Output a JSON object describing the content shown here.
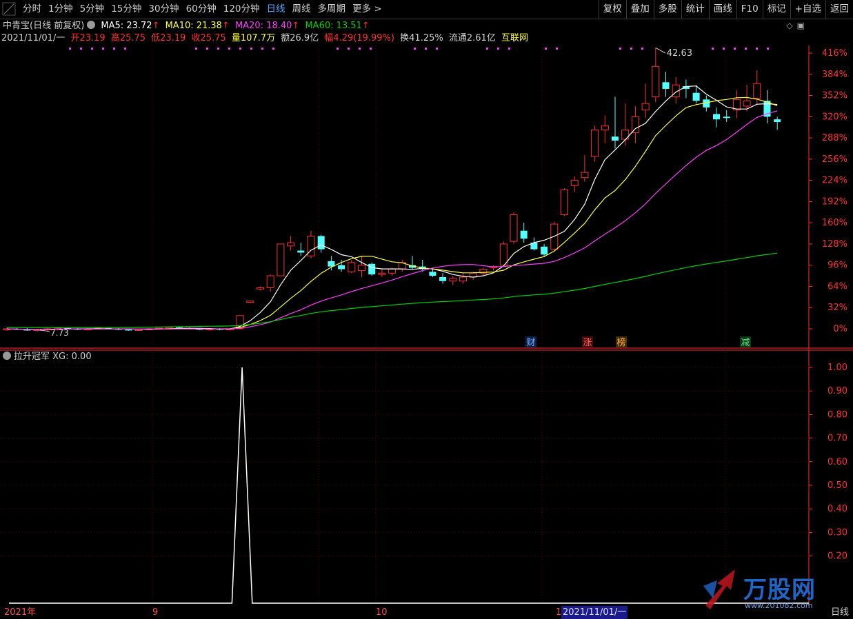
{
  "toolbar": {
    "periods": [
      {
        "label": "分时"
      },
      {
        "label": "1分钟"
      },
      {
        "label": "5分钟"
      },
      {
        "label": "15分钟"
      },
      {
        "label": "30分钟"
      },
      {
        "label": "60分钟"
      },
      {
        "label": "120分钟"
      },
      {
        "label": "日线",
        "active": true
      },
      {
        "label": "周线"
      },
      {
        "label": "多周期"
      },
      {
        "label": "更多 >"
      }
    ],
    "right_buttons": [
      "复权",
      "叠加",
      "多股",
      "统计",
      "画线",
      "F10",
      "标记",
      "+自选",
      "返回"
    ]
  },
  "stock": {
    "name": "中青宝(日线 前复权)",
    "ma5": "MA5: 23.72",
    "ma10": "MA10: 21.38",
    "ma20": "MA20: 18.40",
    "ma60": "MA60: 13.51",
    "date": "2021/11/01/一",
    "open": "开23.19",
    "high": "高25.75",
    "low": "低23.19",
    "close": "收25.75",
    "volume": "量107.7万",
    "amount": "额26.9亿",
    "change": "幅4.29(19.99%)",
    "turnover": "换41.25%",
    "float": "流通2.61亿",
    "sector": "互联网"
  },
  "colors": {
    "up": "#ff3030",
    "down": "#54ffff",
    "ma5": "#ffffff",
    "ma10": "#ffff3c",
    "ma20": "#ff3cff",
    "ma60": "#00d000",
    "axis": "#ff3030",
    "grid": "#5a0000"
  },
  "price_axis": {
    "labels": [
      "416%",
      "384%",
      "352%",
      "320%",
      "288%",
      "256%",
      "224%",
      "192%",
      "160%",
      "128%",
      "96%",
      "64%",
      "32%",
      "0%"
    ]
  },
  "annotations": {
    "high_label": "42.63",
    "low_label": "7.73",
    "events": [
      "财",
      "涨",
      "榜",
      "减"
    ]
  },
  "indicator": {
    "name": "拉升冠军",
    "value": "XG: 0.00",
    "axis_labels": [
      "1.00",
      "0.90",
      "0.80",
      "0.70",
      "0.60",
      "0.50",
      "0.40",
      "0.30",
      "0.20"
    ]
  },
  "xaxis": {
    "labels": [
      "2021年",
      "9",
      "10",
      "1",
      "2021/11/01/一"
    ],
    "period": "日线"
  },
  "watermark": {
    "brand": "万股网",
    "url": "www.201082.com"
  },
  "chart_data": [
    {
      "type": "candlestick",
      "title": "中青宝(日线 前复权)",
      "y_axis": "percent change",
      "ylim": [
        0,
        416
      ],
      "candles_pct": [
        [
          0,
          2,
          -3,
          0
        ],
        [
          0,
          1,
          -2,
          -1
        ],
        [
          -1,
          1,
          -3,
          -2
        ],
        [
          -2,
          0,
          -4,
          -1
        ],
        [
          -1,
          1,
          -3,
          0
        ],
        [
          0,
          2,
          -2,
          1
        ],
        [
          1,
          2,
          -1,
          0
        ],
        [
          0,
          1,
          -2,
          -1
        ],
        [
          -1,
          1,
          -2,
          0
        ],
        [
          0,
          2,
          -1,
          1
        ],
        [
          1,
          2,
          -1,
          0
        ],
        [
          0,
          1,
          -2,
          -1
        ],
        [
          -1,
          0,
          -3,
          -2
        ],
        [
          -2,
          0,
          -3,
          -1
        ],
        [
          -1,
          1,
          -2,
          0
        ],
        [
          0,
          2,
          -1,
          1
        ],
        [
          1,
          3,
          0,
          2
        ],
        [
          2,
          3,
          0,
          1
        ],
        [
          1,
          2,
          -1,
          0
        ],
        [
          0,
          1,
          -2,
          -1
        ],
        [
          -1,
          1,
          -3,
          0
        ],
        [
          0,
          1,
          -2,
          -1
        ],
        [
          -1,
          0,
          -2,
          0
        ],
        [
          0,
          20,
          0,
          20
        ],
        [
          40,
          42,
          40,
          42
        ],
        [
          60,
          64,
          58,
          62
        ],
        [
          62,
          82,
          56,
          80
        ],
        [
          80,
          128,
          80,
          128
        ],
        [
          125,
          140,
          118,
          130
        ],
        [
          118,
          130,
          110,
          115
        ],
        [
          110,
          148,
          106,
          140
        ],
        [
          140,
          142,
          115,
          120
        ],
        [
          102,
          110,
          88,
          94
        ],
        [
          96,
          104,
          86,
          90
        ],
        [
          86,
          104,
          84,
          100
        ],
        [
          88,
          110,
          78,
          96
        ],
        [
          98,
          100,
          80,
          82
        ],
        [
          82,
          90,
          78,
          84
        ],
        [
          84,
          92,
          80,
          90
        ],
        [
          90,
          104,
          86,
          100
        ],
        [
          96,
          110,
          90,
          92
        ],
        [
          94,
          104,
          86,
          90
        ],
        [
          86,
          92,
          78,
          80
        ],
        [
          78,
          84,
          68,
          72
        ],
        [
          72,
          80,
          66,
          76
        ],
        [
          72,
          84,
          68,
          78
        ],
        [
          78,
          86,
          74,
          84
        ],
        [
          84,
          92,
          80,
          90
        ],
        [
          92,
          96,
          88,
          94
        ],
        [
          96,
          132,
          94,
          128
        ],
        [
          132,
          176,
          128,
          172
        ],
        [
          148,
          160,
          130,
          136
        ],
        [
          130,
          138,
          118,
          120
        ],
        [
          124,
          128,
          108,
          112
        ],
        [
          120,
          162,
          118,
          158
        ],
        [
          172,
          212,
          170,
          210
        ],
        [
          216,
          230,
          206,
          224
        ],
        [
          228,
          262,
          222,
          236
        ],
        [
          260,
          306,
          252,
          300
        ],
        [
          300,
          322,
          280,
          306
        ],
        [
          290,
          350,
          272,
          284
        ],
        [
          286,
          340,
          276,
          300
        ],
        [
          296,
          336,
          280,
          320
        ],
        [
          330,
          370,
          318,
          340
        ],
        [
          350,
          424,
          342,
          396
        ],
        [
          372,
          388,
          350,
          362
        ],
        [
          350,
          380,
          340,
          368
        ],
        [
          366,
          376,
          348,
          362
        ],
        [
          356,
          368,
          340,
          344
        ],
        [
          346,
          352,
          328,
          334
        ],
        [
          324,
          334,
          304,
          316
        ],
        [
          320,
          330,
          312,
          318
        ],
        [
          330,
          360,
          318,
          346
        ],
        [
          336,
          368,
          328,
          344
        ],
        [
          348,
          390,
          338,
          370
        ],
        [
          344,
          360,
          310,
          320
        ],
        [
          316,
          320,
          300,
          312
        ]
      ],
      "series": [
        {
          "name": "MA5",
          "value": 23.72
        },
        {
          "name": "MA10",
          "value": 21.38
        },
        {
          "name": "MA20",
          "value": 18.4
        },
        {
          "name": "MA60",
          "value": 13.51
        }
      ]
    },
    {
      "type": "line",
      "title": "拉升冠军",
      "series": [
        {
          "name": "XG",
          "values": [
            0,
            0,
            0,
            0,
            0,
            0,
            0,
            0,
            0,
            0,
            0,
            0,
            0,
            0,
            0,
            0,
            0,
            0,
            0,
            0,
            0,
            0,
            0,
            1,
            0,
            0,
            0,
            0,
            0,
            0,
            0,
            0,
            0,
            0,
            0,
            0,
            0,
            0,
            0,
            0,
            0,
            0,
            0,
            0,
            0,
            0,
            0,
            0,
            0,
            0,
            0,
            0,
            0,
            0,
            0,
            0,
            0,
            0,
            0,
            0,
            0,
            0,
            0,
            0,
            0,
            0,
            0,
            0,
            0,
            0,
            0,
            0,
            0,
            0,
            0,
            0,
            0
          ]
        }
      ],
      "ylim": [
        0,
        1
      ]
    }
  ]
}
